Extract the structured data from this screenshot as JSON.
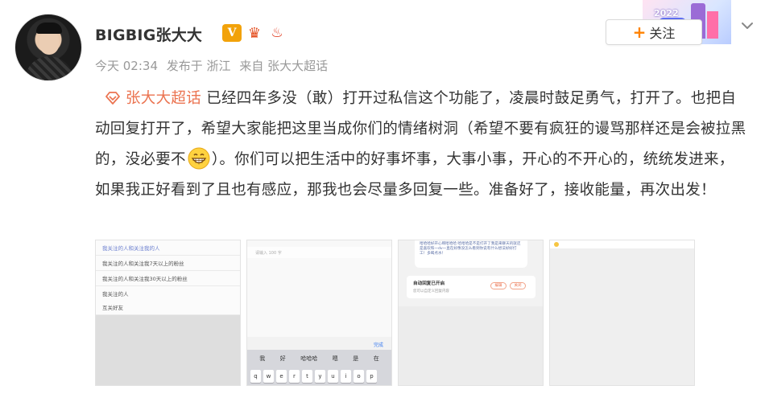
{
  "user": {
    "name": "BIGBIG张大大",
    "badges": [
      "V",
      "crown",
      "flame"
    ]
  },
  "meta": {
    "time": "今天 02:34",
    "location": "发布于 浙江",
    "source": "来自 张大大超话"
  },
  "follow": {
    "label": "关注",
    "plus": "+"
  },
  "banner": {
    "text": "2022"
  },
  "post": {
    "topic": "张大大超话",
    "text_before_emoji": "已经四年多没（敢）打开过私信这个功能了，凌晨时鼓足勇气，打开了。也把自动回复打开了，希望大家能把这里当成你们的情绪树洞（希望不要有疯狂的谩骂那样还是会被拉黑的，没必要不",
    "text_after_emoji": "）。你们可以把生活中的好事坏事，大事小事，开心的不开心的，统统发进来，如果我正好看到了且也有感应，那我也会尽量多回复一些。准备好了，接收能量，再次出发！"
  },
  "thumb1": {
    "rows": [
      "我关注的人和关注我的人",
      "我关注的人和关注我7天以上的粉丝",
      "我关注的人和关注我30天以上的粉丝",
      "我关注的人",
      "互关好友"
    ]
  },
  "thumb2": {
    "input_placeholder": "请输入 100 字",
    "done": "完成",
    "suggestions": [
      "我",
      "好",
      "哈哈哈",
      "嗯",
      "是",
      "在"
    ],
    "keys": [
      "q",
      "w",
      "e",
      "r",
      "t",
      "y",
      "u",
      "i",
      "o",
      "p"
    ]
  },
  "thumb3": {
    "message": "哈哈哈好开心啊哈哈哈 哈哈哈是不是打开了我是来聊天的就还是喜欢和一dv一直在好像没怎么看到你说有什么想法好好打工！多喝点水！",
    "card_title": "自动回复已开启",
    "card_sub": "您可以自定义回复内容",
    "pill_1": "编辑",
    "pill_2": "关闭"
  }
}
